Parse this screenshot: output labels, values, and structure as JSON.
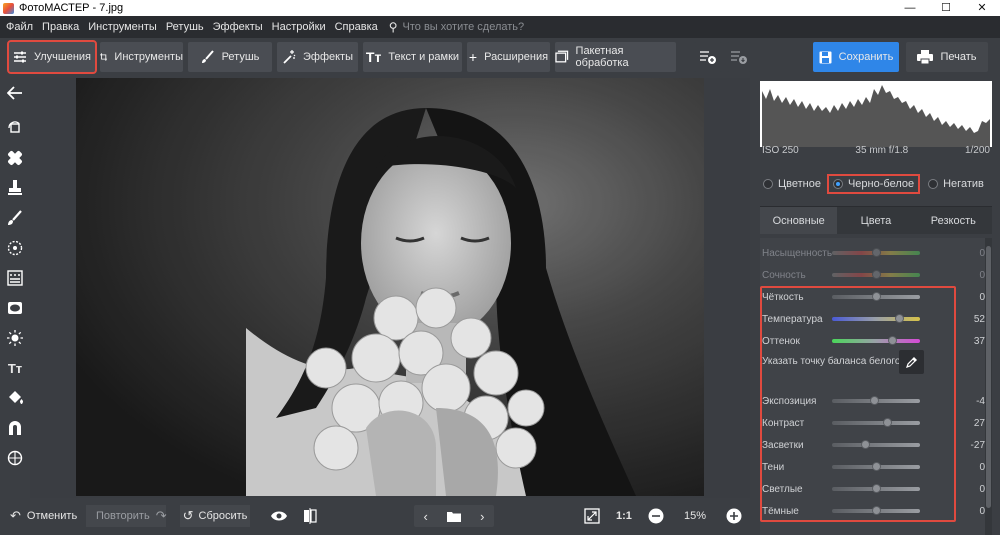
{
  "window": {
    "title": "ФотоМАСТЕР - 7.jpg",
    "buttons": [
      "—",
      "☐",
      "✕"
    ]
  },
  "menu": {
    "items": [
      "Файл",
      "Правка",
      "Инструменты",
      "Ретушь",
      "Эффекты",
      "Настройки",
      "Справка"
    ],
    "search_placeholder": "Что вы хотите сделать?"
  },
  "toolbar": {
    "tabs": [
      {
        "label": "Улучшения",
        "icon": "sliders-icon",
        "active": true
      },
      {
        "label": "Инструменты",
        "icon": "crop-icon"
      },
      {
        "label": "Ретушь",
        "icon": "brush-icon"
      },
      {
        "label": "Эффекты",
        "icon": "magic-icon"
      },
      {
        "label": "Текст и рамки",
        "icon": "text-icon"
      },
      {
        "label": "Расширения",
        "icon": "plus-icon"
      },
      {
        "label": "Пакетная обработка",
        "icon": "batch-icon"
      }
    ],
    "save_label": "Сохранить",
    "print_label": "Печать"
  },
  "left_tools": [
    "back-arrow-icon",
    "rotate-icon",
    "heal-icon",
    "stamp-icon",
    "brush-icon",
    "radial-icon",
    "gradient-icon",
    "vignette-icon",
    "light-icon",
    "text-icon",
    "fill-icon",
    "magnet-icon",
    "globe-icon"
  ],
  "histogram": {
    "iso": "ISO 250",
    "lens": "35 mm f/1.8",
    "shutter": "1/200"
  },
  "color_modes": {
    "color": "Цветное",
    "bw": "Черно-белое",
    "negative": "Негатив",
    "selected": "bw"
  },
  "panel_tabs": [
    "Основные",
    "Цвета",
    "Резкость"
  ],
  "sliders": [
    {
      "label": "Насыщенность",
      "value": "0",
      "pos": 0.5,
      "dim": true,
      "track": "sat"
    },
    {
      "label": "Сочность",
      "value": "0",
      "pos": 0.5,
      "dim": true,
      "track": "sat"
    },
    {
      "label": "Чёткость",
      "value": "0",
      "pos": 0.5,
      "track": "gray"
    },
    {
      "label": "Температура",
      "value": "52",
      "pos": 0.76,
      "track": "temp"
    },
    {
      "label": "Оттенок",
      "value": "37",
      "pos": 0.68,
      "track": "tint"
    },
    {
      "label": "Экспозиция",
      "value": "-4",
      "pos": 0.48,
      "track": "gray"
    },
    {
      "label": "Контраст",
      "value": "27",
      "pos": 0.63,
      "track": "gray"
    },
    {
      "label": "Засветки",
      "value": "-27",
      "pos": 0.37,
      "track": "gray"
    },
    {
      "label": "Тени",
      "value": "0",
      "pos": 0.5,
      "track": "gray"
    },
    {
      "label": "Светлые",
      "value": "0",
      "pos": 0.5,
      "track": "gray"
    },
    {
      "label": "Тёмные",
      "value": "0",
      "pos": 0.5,
      "track": "gray"
    }
  ],
  "white_balance_label": "Указать точку баланса белого",
  "bottom": {
    "undo": "Отменить",
    "redo": "Повторить",
    "reset": "Сбросить",
    "ratio": "1:1",
    "zoom": "15%"
  }
}
